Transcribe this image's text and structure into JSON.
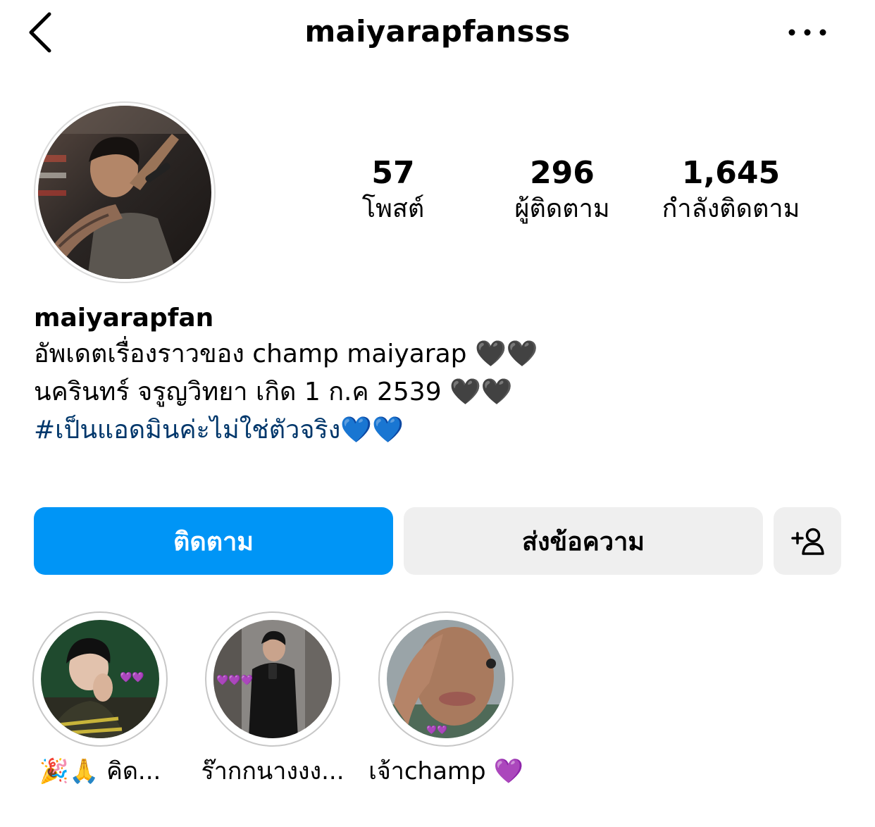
{
  "header": {
    "username": "maiyarapfansss",
    "back_icon": "chevron-left-icon",
    "more_icon": "ellipsis-icon"
  },
  "stats": {
    "posts": {
      "value": "57",
      "label": "โพสต์"
    },
    "followers": {
      "value": "296",
      "label": "ผู้ติดตาม"
    },
    "following": {
      "value": "1,645",
      "label": "กำลังติดตาม"
    }
  },
  "bio": {
    "name": "maiyarapfan",
    "line1": "อัพเดตเรื่องราวของ champ maiyarap 🖤🖤",
    "line2": "นครินทร์ จรูญวิทยา เกิด 1 ก.ค 2539  🖤🖤",
    "hashtag": "#เป็นแอดมินค่ะไม่ใช่ตัวจริง💙💙"
  },
  "actions": {
    "follow_label": "ติดตาม",
    "message_label": "ส่งข้อความ",
    "add_user_icon": "add-user-icon"
  },
  "highlights": [
    {
      "label": "🎉🙏 คิด..."
    },
    {
      "label": "ร๊ากกนางงง..."
    },
    {
      "label": "เจ้าchamp 💜"
    }
  ],
  "colors": {
    "primary_blue": "#0095f6",
    "secondary_button": "#efefef",
    "hashtag_blue": "#00376b",
    "ring_gray": "#c7c7c7"
  }
}
